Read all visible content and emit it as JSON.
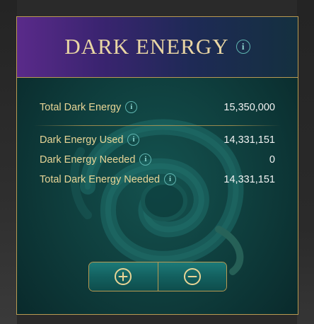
{
  "panel": {
    "title": "DARK ENERGY",
    "info_glyph": "i"
  },
  "stats": [
    {
      "label": "Total Dark Energy",
      "value": "15,350,000"
    },
    {
      "label": "Dark Energy Used",
      "value": "14,331,151"
    },
    {
      "label": "Dark Energy Needed",
      "value": "0"
    },
    {
      "label": "Total Dark Energy Needed",
      "value": "14,331,151"
    }
  ],
  "controls": {
    "increase_icon": "plus-circle-icon",
    "decrease_icon": "minus-circle-icon"
  },
  "colors": {
    "gold": "#b99a52",
    "label": "#e8d596",
    "value": "#f2f2f2",
    "teal_button": "#13605f"
  }
}
